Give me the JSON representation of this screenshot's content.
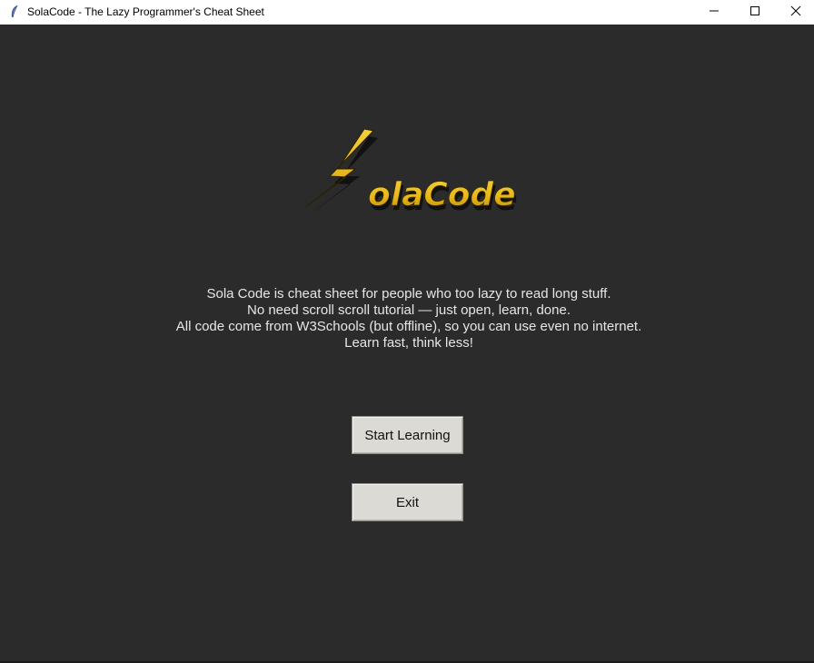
{
  "window": {
    "title": "SolaCode - The Lazy Programmer's Cheat Sheet",
    "controls": {
      "minimize_icon": "minimize-icon",
      "maximize_icon": "maximize-icon",
      "close_icon": "close-icon"
    }
  },
  "logo": {
    "text": "SolaCode",
    "color": "#e8b81a"
  },
  "description": {
    "lines": [
      "Sola Code is cheat sheet for people who too lazy to read long stuff.",
      "No need scroll scroll tutorial — just open, learn, done.",
      "All code come from W3Schools (but offline), so you can use even no internet.",
      "Learn fast, think less!"
    ]
  },
  "buttons": {
    "start_label": "Start Learning",
    "exit_label": "Exit"
  },
  "colors": {
    "background": "#2b2b2b",
    "text": "#e6e6e6",
    "button_face": "#dcdad5",
    "logo_yellow": "#e8b81a"
  }
}
